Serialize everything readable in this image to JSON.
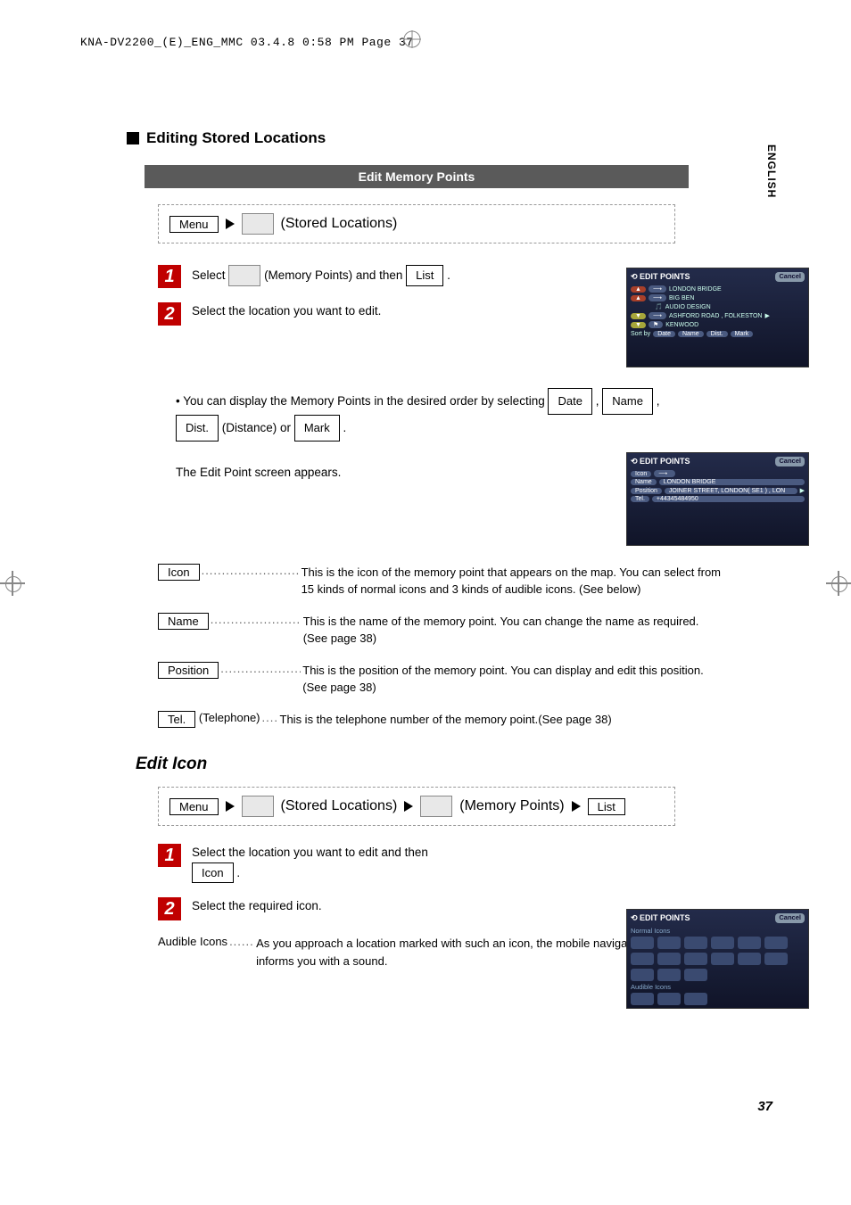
{
  "header": {
    "line": "KNA-DV2200_(E)_ENG_MMC  03.4.8  0:58 PM  Page 37"
  },
  "lang_tab": "ENGLISH",
  "section_title": "Editing Stored Locations",
  "subsection_bar": "Edit Memory Points",
  "crumb1": {
    "menu": "Menu",
    "stored_locations": "(Stored Locations)"
  },
  "steps1": {
    "s1_prefix": "Select",
    "s1_mid": "(Memory Points) and then",
    "s1_list": "List",
    "s2": "Select the location you want to edit."
  },
  "shot1": {
    "title": "EDIT POINTS",
    "cancel": "Cancel",
    "rows": [
      "LONDON BRIDGE",
      "BIG BEN",
      "AUDIO DESIGN",
      "ASHFORD ROAD , FOLKESTON",
      "KENWOOD"
    ],
    "sortby": "Sort by",
    "sorts": [
      "Date",
      "Name",
      "Dist.",
      "Mark"
    ]
  },
  "note1": {
    "prefix": "• You can display the Memory Points in the desired order by selecting",
    "date": "Date",
    "comma": ",",
    "name": "Name",
    "dist": "Dist.",
    "distance_or": "(Distance) or",
    "mark": "Mark",
    "period": "."
  },
  "edit_appears": "The Edit Point screen appears.",
  "shot2": {
    "title": "EDIT POINTS",
    "cancel": "Cancel",
    "btn_icon": "Icon",
    "btn_name": "Name",
    "name_val": "LONDON BRIDGE",
    "btn_pos": "Position",
    "pos_val": "JOINER STREET,  LONDON( SE1 ) , LON",
    "btn_tel": "Tel.",
    "tel_val": "+44345484950"
  },
  "defs": {
    "icon": {
      "label": "Icon",
      "text": "This is the icon of the memory point that appears on the map. You can select from 15 kinds of normal icons and 3 kinds of audible icons. (See below)"
    },
    "name": {
      "label": "Name",
      "text": "This is the name of the memory point. You can change the name as required. (See page 38)"
    },
    "position": {
      "label": "Position",
      "text": "This is the position of the memory point. You can display and edit this position. (See page 38)"
    },
    "tel": {
      "label": "Tel.",
      "suffix": "(Telephone) ",
      "text": "This is the telephone number of the memory point.(See page 38)"
    }
  },
  "subheading": "Edit Icon",
  "crumb2": {
    "menu": "Menu",
    "stored_locations": "(Stored Locations)",
    "memory_points": "(Memory Points)",
    "list": "List"
  },
  "steps2": {
    "s1": "Select the location you want to edit and then",
    "s1_icon": "Icon",
    "s2": "Select the required icon."
  },
  "shot3": {
    "title": "EDIT POINTS",
    "cancel": "Cancel",
    "normal": "Normal Icons",
    "audible": "Audible Icons"
  },
  "audible_note": {
    "label": "Audible Icons ",
    "text": "As you approach a location marked with such an icon, the mobile navigation system informs you with a sound."
  },
  "page_num": "37"
}
